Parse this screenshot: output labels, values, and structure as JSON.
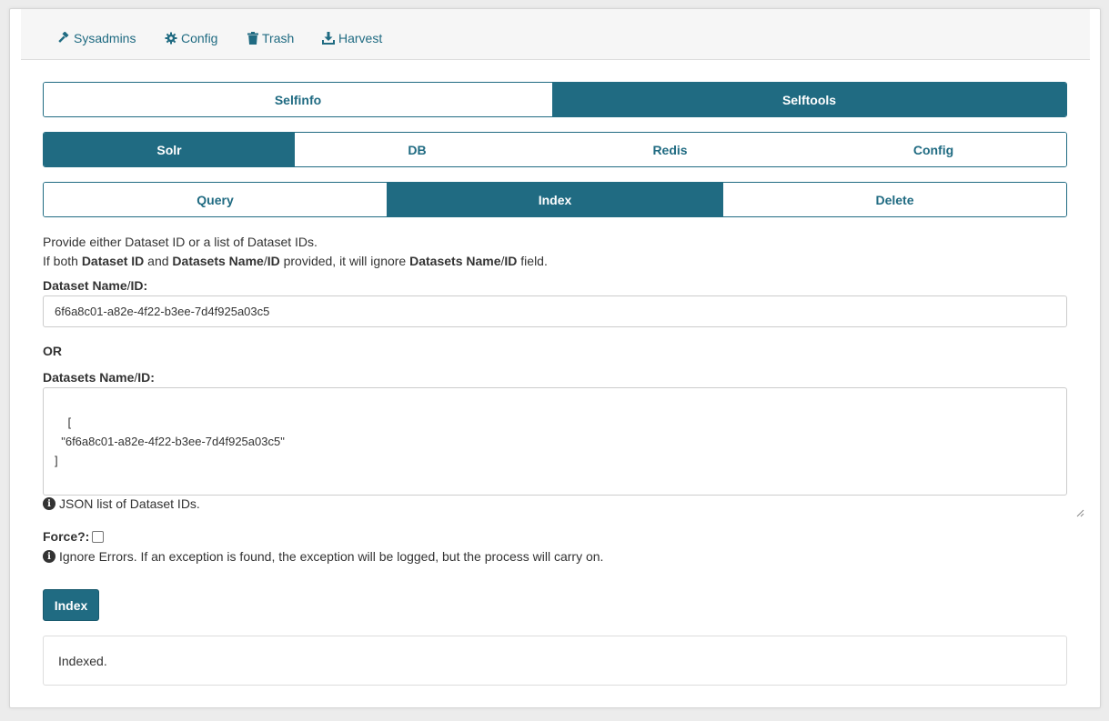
{
  "topnav": {
    "items": [
      {
        "label": "Sysadmins",
        "icon": "gavel-icon"
      },
      {
        "label": "Config",
        "icon": "gear-icon"
      },
      {
        "label": "Trash",
        "icon": "trash-icon"
      },
      {
        "label": "Harvest",
        "icon": "download-icon"
      }
    ]
  },
  "main_tabs": [
    {
      "label": "Selfinfo",
      "active": false
    },
    {
      "label": "Selftools",
      "active": true
    }
  ],
  "tool_tabs": [
    {
      "label": "Solr",
      "active": true
    },
    {
      "label": "DB",
      "active": false
    },
    {
      "label": "Redis",
      "active": false
    },
    {
      "label": "Config",
      "active": false
    }
  ],
  "action_tabs": [
    {
      "label": "Query",
      "active": false
    },
    {
      "label": "Index",
      "active": true
    },
    {
      "label": "Delete",
      "active": false
    }
  ],
  "help": {
    "line1": "Provide either Dataset ID or a list of Dataset IDs.",
    "line2_prefix": "If both ",
    "line2_bold1": "Dataset ID",
    "line2_and": " and ",
    "line2_bold2": "Datasets Name",
    "line2_slash": "/",
    "line2_bold3": "ID",
    "line2_mid": " provided, it will ignore ",
    "line2_bold4": "Datasets Name",
    "line2_slash2": "/",
    "line2_bold5": "ID",
    "line2_suffix": " field."
  },
  "form": {
    "dataset_label_bold": "Dataset Name",
    "dataset_label_slash": "/",
    "dataset_label_bold2": "ID:",
    "dataset_value": "6f6a8c01-a82e-4f22-b3ee-7d4f925a03c5",
    "or_label": "OR",
    "datasets_label_bold": "Datasets Name",
    "datasets_label_slash": "/",
    "datasets_label_bold2": "ID:",
    "datasets_value": "[\n  \"6f6a8c01-a82e-4f22-b3ee-7d4f925a03c5\"\n]",
    "datasets_hint": "JSON list of Dataset IDs.",
    "force_label": "Force?:",
    "force_checked": false,
    "force_hint": "Ignore Errors. If an exception is found, the exception will be logged, but the process will carry on.",
    "submit_label": "Index"
  },
  "result": {
    "message": "Indexed."
  },
  "colors": {
    "accent": "#206b82"
  }
}
